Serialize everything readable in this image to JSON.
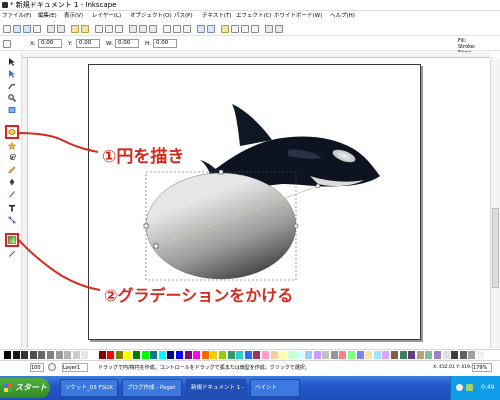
{
  "window": {
    "title": "* 新規ドキュメント 1 - Inkscape"
  },
  "menubar": [
    "ファイル(F)",
    "編集(E)",
    "表示(V)",
    "レイヤー(L)",
    "オブジェクト(O)",
    "パス(P)",
    "テキスト(T)",
    "エフェクト(C)",
    "ホワイトボード(W)",
    "ヘルプ(H)"
  ],
  "controlbar": {
    "x_label": "X:",
    "x_value": "0.00",
    "y_label": "Y:",
    "y_value": "0.00",
    "w_label": "W:",
    "w_value": "0.00",
    "h_label": "H:",
    "h_value": "0.00"
  },
  "style_indicator": {
    "fill": "Fill:",
    "stroke": "Stroke:",
    "width": "None"
  },
  "tools": [
    {
      "icon": "selector-icon"
    },
    {
      "icon": "node-icon"
    },
    {
      "icon": "tweak-icon"
    },
    {
      "icon": "zoom-icon"
    },
    {
      "icon": "rectangle-icon"
    },
    {
      "icon": "ellipse-icon",
      "selected": true
    },
    {
      "icon": "star-icon"
    },
    {
      "icon": "spiral-icon"
    },
    {
      "icon": "pencil-icon"
    },
    {
      "icon": "pen-icon"
    },
    {
      "icon": "calligraphy-icon"
    },
    {
      "icon": "text-icon"
    },
    {
      "icon": "connector-icon"
    },
    {
      "icon": "gradient-icon",
      "selected": true
    },
    {
      "icon": "dropper-icon"
    }
  ],
  "annotations": {
    "step1": "①円を描き",
    "step2": "②グラデーションをかける",
    "color": "#d42a1d"
  },
  "palette": [
    "#000000",
    "#1a1a1a",
    "#333333",
    "#4d4d4d",
    "#666666",
    "#808080",
    "#999999",
    "#b3b3b3",
    "#cccccc",
    "#e6e6e6",
    "#ffffff",
    "#800000",
    "#ff0000",
    "#808000",
    "#ffff00",
    "#008000",
    "#00ff00",
    "#008080",
    "#00ffff",
    "#000080",
    "#0000ff",
    "#800080",
    "#ff00ff",
    "#ff6600",
    "#ffcc00",
    "#99cc00",
    "#339966",
    "#33cccc",
    "#3366ff",
    "#993366",
    "#ff99cc",
    "#ffcc99",
    "#ffff99",
    "#ccffcc",
    "#ccffff",
    "#99ccff",
    "#cc99ff",
    "#c0c0c0",
    "#969696",
    "#ff8080",
    "#80ff80",
    "#8080ff",
    "#ffe0a0",
    "#a0e0ff",
    "#e0a0ff",
    "#7f5f3f",
    "#3f7f5f",
    "#5f3f7f",
    "#bf9f7f",
    "#7fbf9f",
    "#9f7fbf",
    "#dfdfdf",
    "#404040",
    "#606060",
    "#a0a0a0",
    "#f0f0f0"
  ],
  "statusbar": {
    "layer": "Layer1",
    "opacity": "100",
    "message": "ドラッグで円/楕円を作成。コントロールをドラッグで弧または扇型を作成。クリックで選択。",
    "coords": "X: 432.01  Y: 419.55",
    "zoom": "179%"
  },
  "taskbar": {
    "start": "スタート",
    "tasks": [
      "ソケット_03 FSGK",
      "ブログ作成 - Paget",
      "新規ドキュメント 1 -",
      "ペイント"
    ],
    "clock": "0:49"
  }
}
